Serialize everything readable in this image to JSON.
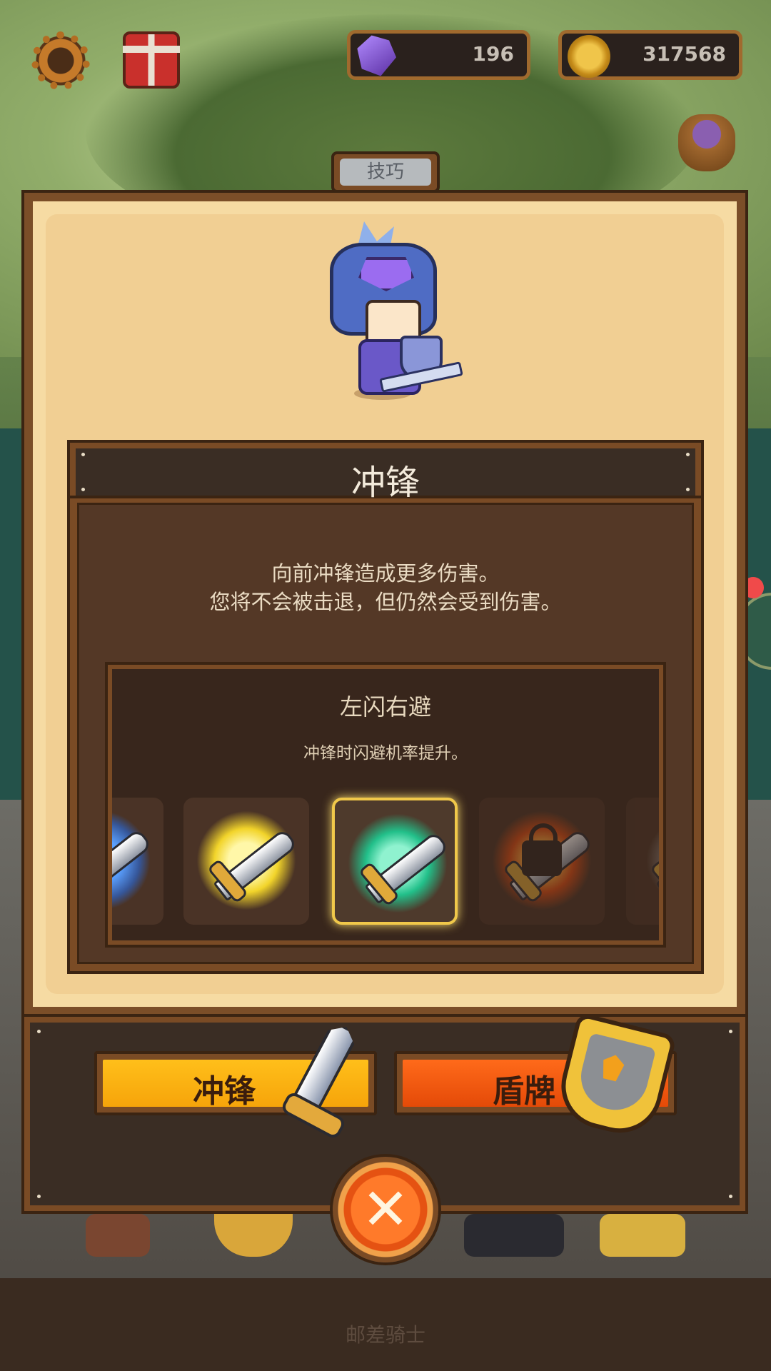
{
  "top_bar": {
    "gems": "196",
    "coins": "317568"
  },
  "panel": {
    "tab_label": "技巧",
    "skill_name": "冲锋",
    "skill_description": "向前冲锋造成更多伤害。\n您将不会被击退，但仍然会受到伤害。",
    "upgrade": {
      "title": "左闪右避",
      "description": "冲锋时闪避机率提升。",
      "cards": [
        {
          "icon": "blue-wave-sword-icon",
          "state": "partial"
        },
        {
          "icon": "golden-burst-sword-icon",
          "state": "unlocked"
        },
        {
          "icon": "green-swirl-sword-icon",
          "state": "selected"
        },
        {
          "icon": "locked-explosion-sword-icon",
          "state": "locked"
        },
        {
          "icon": "speed-sword-icon",
          "state": "partial-locked"
        }
      ]
    }
  },
  "choices": {
    "charge_label": "冲锋",
    "shield_label": "盾牌"
  },
  "close_icon": "close-icon",
  "footer": "邮差骑士",
  "colors": {
    "parchment": "#f1cf93",
    "panel_dark": "#3a2d24",
    "charge_button": "#ffbf1a",
    "shield_button": "#e44a08",
    "selected_card_border": "#f0c84a"
  }
}
